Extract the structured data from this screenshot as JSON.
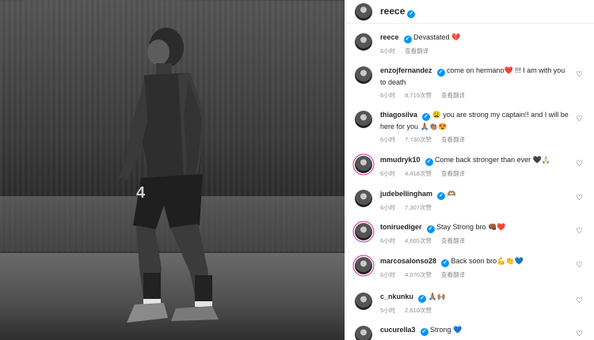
{
  "post": {
    "author": "reece",
    "verified_mark": "✓"
  },
  "comments": [
    {
      "user": "reece",
      "text": "Devastated 💔",
      "time": "6小时",
      "likes": "",
      "translate": "查看翻译",
      "liked": false,
      "ring": false
    },
    {
      "user": "enzojfernandez",
      "text": "come on hermano❤️ !!! I am with you to death",
      "time": "6小时",
      "likes": "8,719次赞",
      "translate": "查看翻译",
      "liked": false,
      "ring": false
    },
    {
      "user": "thiagosilva",
      "text": "😩 you are strong my captain!! and I will be here for you 🙏🏽👏🏽😍",
      "time": "6小时",
      "likes": "7,730次赞",
      "translate": "查看翻译",
      "liked": false,
      "ring": false
    },
    {
      "user": "mmudryk10",
      "text": "Come back stronger than ever 🖤🙏🏻",
      "time": "6小时",
      "likes": "4,418次赞",
      "translate": "查看翻译",
      "liked": false,
      "ring": true
    },
    {
      "user": "judebellingham",
      "text": "🫶🏽",
      "time": "6小时",
      "likes": "7,307次赞",
      "translate": "",
      "liked": false,
      "ring": false
    },
    {
      "user": "toniruediger",
      "text": "Stay Strong bro 👊🏾❤️",
      "time": "6小时",
      "likes": "4,665次赞",
      "translate": "查看翻译",
      "liked": false,
      "ring": true
    },
    {
      "user": "marcosalonso28",
      "text": "Back soon bro💪👏💙",
      "time": "6小时",
      "likes": "4,070次赞",
      "translate": "查看翻译",
      "liked": false,
      "ring": true
    },
    {
      "user": "c_nkunku",
      "text": "🙏🏽🙌🏽",
      "time": "5小时",
      "likes": "2,610次赞",
      "translate": "",
      "liked": false,
      "ring": false
    },
    {
      "user": "cucurella3",
      "text": "Strong 💙",
      "time": "",
      "likes": "",
      "translate": "",
      "liked": false,
      "ring": false
    }
  ],
  "icons": {
    "heart": "heart-outline-icon"
  }
}
